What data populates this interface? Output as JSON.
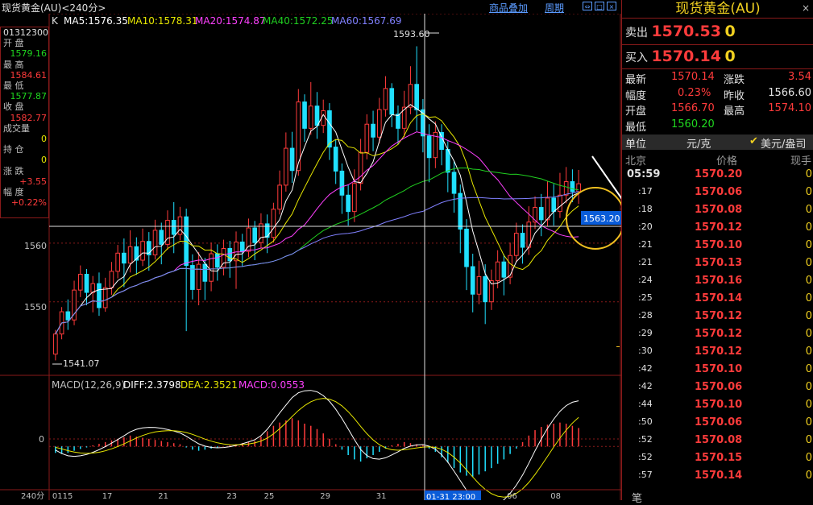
{
  "title": "现货黄金(AU)<240分>",
  "toolbar": {
    "overlay_label": "商品叠加",
    "period_label": "周期"
  },
  "ma_legend": {
    "k": "K",
    "ma5": "MA5:1576.35",
    "ma10": "MA10:1578.31",
    "ma20": "MA20:1574.87",
    "ma40": "MA40:1572.25",
    "ma60": "MA60:1567.69"
  },
  "info_panel": {
    "date": "01312300",
    "open_label": "开  盘",
    "open_value": "1579.16",
    "high_label": "最  高",
    "high_value": "1584.61",
    "low_label": "最  低",
    "low_value": "1577.87",
    "close_label": "收  盘",
    "close_value": "1582.77",
    "volume_label": "成交量",
    "volume_value": "0",
    "hold_label": "持  仓",
    "hold_value": "0",
    "change_label": "涨  跌",
    "change_value": "+3.55",
    "pct_label": "幅  度",
    "pct_value": "+0.22%"
  },
  "price_axis": {
    "label_1560": "1560",
    "label_1550": "1550"
  },
  "annotations": {
    "high": "1593.60",
    "low": "1541.07",
    "crosshair_price": "1563.20",
    "crosshair_time": "01-31 23:00"
  },
  "macd_legend": {
    "name": "MACD(12,26,9)",
    "diff": "DIFF:2.3798",
    "dea": "DEA:2.3521",
    "macd": "MACD:0.0553",
    "zero": "0"
  },
  "x_axis": {
    "period": "240分",
    "labels": [
      "0115",
      "17",
      "21",
      "23",
      "25",
      "29",
      "31",
      "06",
      "08"
    ]
  },
  "right_panel": {
    "title": "现货黄金(AU)",
    "sell_label": "卖出",
    "sell_price": "1570.53",
    "sell_vol": "0",
    "buy_label": "买入",
    "buy_price": "1570.14",
    "buy_vol": "0",
    "quote": {
      "latest_label": "最新",
      "latest_value": "1570.14",
      "change_label": "涨跌",
      "change_value": "3.54",
      "amplitude_label": "幅度",
      "amplitude_value": "0.23%",
      "prev_close_label": "昨收",
      "prev_close_value": "1566.60",
      "open_label": "开盘",
      "open_value": "1566.70",
      "high_label": "最高",
      "high_value": "1574.10",
      "low_label": "最低",
      "low_value": "1560.20"
    },
    "unit_label": "单位",
    "unit_value": "元/克",
    "currency_label": "美元/盎司",
    "tick_header": {
      "time": "北京",
      "price": "价格",
      "vol": "现手"
    },
    "ticks": [
      {
        "time": "05:59",
        "price": "1570.20",
        "vol": "0"
      },
      {
        "time": ":17",
        "price": "1570.06",
        "vol": "0"
      },
      {
        "time": ":18",
        "price": "1570.08",
        "vol": "0"
      },
      {
        "time": ":20",
        "price": "1570.12",
        "vol": "0"
      },
      {
        "time": ":21",
        "price": "1570.10",
        "vol": "0"
      },
      {
        "time": ":21",
        "price": "1570.13",
        "vol": "0"
      },
      {
        "time": ":24",
        "price": "1570.16",
        "vol": "0"
      },
      {
        "time": ":25",
        "price": "1570.14",
        "vol": "0"
      },
      {
        "time": ":28",
        "price": "1570.12",
        "vol": "0"
      },
      {
        "time": ":29",
        "price": "1570.12",
        "vol": "0"
      },
      {
        "time": ":30",
        "price": "1570.12",
        "vol": "0"
      },
      {
        "time": ":42",
        "price": "1570.10",
        "vol": "0"
      },
      {
        "time": ":42",
        "price": "1570.06",
        "vol": "0"
      },
      {
        "time": ":44",
        "price": "1570.10",
        "vol": "0"
      },
      {
        "time": ":50",
        "price": "1570.06",
        "vol": "0"
      },
      {
        "time": ":52",
        "price": "1570.08",
        "vol": "0"
      },
      {
        "time": ":52",
        "price": "1570.15",
        "vol": "0"
      },
      {
        "time": ":57",
        "price": "1570.14",
        "vol": "0"
      }
    ],
    "footer_char": "笔"
  },
  "chart_data": [
    {
      "type": "candlestick",
      "ylim": [
        1538,
        1596
      ],
      "ticks": [
        1550,
        1560
      ],
      "series_colors": {
        "ma5": "#ffffff",
        "ma10": "#e8e800",
        "ma20": "#ff40ff",
        "ma40": "#20d020",
        "ma60": "#8080ff",
        "up": "#ff3b3b",
        "down": "#20e0ff"
      },
      "candles": [
        [
          1541.07,
          1544.5,
          1540.0,
          1545.2
        ],
        [
          1544.5,
          1548.3,
          1543.6,
          1549.1
        ],
        [
          1548.3,
          1546.9,
          1545.2,
          1550.4
        ],
        [
          1546.9,
          1552.0,
          1546.0,
          1553.6
        ],
        [
          1552.0,
          1554.7,
          1550.8,
          1556.2
        ],
        [
          1554.7,
          1551.6,
          1549.4,
          1555.6
        ],
        [
          1551.6,
          1553.1,
          1548.2,
          1554.4
        ],
        [
          1553.1,
          1549.0,
          1547.6,
          1555.0
        ],
        [
          1549.0,
          1552.4,
          1548.3,
          1554.1
        ],
        [
          1552.4,
          1555.2,
          1551.2,
          1556.8
        ],
        [
          1555.2,
          1558.3,
          1554.0,
          1559.7
        ],
        [
          1558.3,
          1556.6,
          1552.5,
          1560.8
        ],
        [
          1556.6,
          1559.4,
          1555.0,
          1562.2
        ],
        [
          1559.4,
          1557.1,
          1554.6,
          1561.0
        ],
        [
          1557.1,
          1560.3,
          1556.1,
          1562.5
        ],
        [
          1560.3,
          1558.0,
          1555.3,
          1561.9
        ],
        [
          1558.0,
          1562.2,
          1557.2,
          1564.0
        ],
        [
          1562.2,
          1559.8,
          1556.4,
          1563.5
        ],
        [
          1559.8,
          1563.9,
          1558.9,
          1565.6
        ],
        [
          1563.9,
          1561.5,
          1558.3,
          1567.0
        ],
        [
          1561.5,
          1564.5,
          1560.5,
          1566.2
        ],
        [
          1564.5,
          1556.2,
          1545.0,
          1565.9
        ],
        [
          1556.2,
          1552.1,
          1550.4,
          1558.1
        ],
        [
          1552.1,
          1556.4,
          1549.4,
          1558.5
        ],
        [
          1556.4,
          1553.5,
          1550.3,
          1557.5
        ],
        [
          1553.5,
          1558.2,
          1551.8,
          1560.1
        ],
        [
          1558.2,
          1555.9,
          1553.6,
          1559.8
        ],
        [
          1555.9,
          1559.1,
          1554.5,
          1560.6
        ],
        [
          1559.1,
          1557.0,
          1554.1,
          1560.4
        ],
        [
          1557.0,
          1560.2,
          1552.2,
          1562.0
        ],
        [
          1560.2,
          1558.6,
          1556.0,
          1561.6
        ],
        [
          1558.6,
          1562.6,
          1557.6,
          1564.2
        ],
        [
          1562.6,
          1560.1,
          1557.1,
          1563.8
        ],
        [
          1560.1,
          1563.3,
          1559.2,
          1565.1
        ],
        [
          1563.3,
          1561.0,
          1558.3,
          1564.9
        ],
        [
          1561.0,
          1565.8,
          1560.1,
          1566.9
        ],
        [
          1565.8,
          1569.9,
          1564.9,
          1572.4
        ],
        [
          1569.9,
          1576.2,
          1568.8,
          1578.9
        ],
        [
          1576.2,
          1572.4,
          1570.3,
          1579.0
        ],
        [
          1572.4,
          1584.1,
          1571.5,
          1586.3
        ],
        [
          1584.1,
          1579.6,
          1577.3,
          1585.4
        ],
        [
          1579.6,
          1583.4,
          1578.5,
          1587.5
        ],
        [
          1583.4,
          1580.1,
          1577.8,
          1585.8
        ],
        [
          1580.1,
          1582.6,
          1578.8,
          1584.5
        ],
        [
          1582.6,
          1576.4,
          1574.2,
          1583.9
        ],
        [
          1576.4,
          1572.3,
          1570.1,
          1577.7
        ],
        [
          1572.3,
          1568.2,
          1565.0,
          1573.6
        ],
        [
          1568.2,
          1565.4,
          1563.0,
          1570.0
        ],
        [
          1565.4,
          1570.2,
          1563.6,
          1572.6
        ],
        [
          1570.2,
          1575.5,
          1569.0,
          1577.8
        ],
        [
          1575.5,
          1580.3,
          1574.3,
          1582.0
        ],
        [
          1580.3,
          1578.1,
          1575.7,
          1582.6
        ],
        [
          1578.1,
          1582.8,
          1577.0,
          1584.8
        ],
        [
          1582.8,
          1586.4,
          1581.6,
          1588.5
        ],
        [
          1586.4,
          1582.0,
          1579.8,
          1587.3
        ],
        [
          1582.0,
          1579.6,
          1576.8,
          1583.5
        ],
        [
          1579.6,
          1583.2,
          1578.1,
          1586.0
        ],
        [
          1583.2,
          1587.1,
          1582.0,
          1590.2
        ],
        [
          1587.1,
          1582.77,
          1579.16,
          1593.6
        ],
        [
          1582.77,
          1578.3,
          1575.5,
          1584.6
        ],
        [
          1578.3,
          1574.6,
          1570.4,
          1580.3
        ],
        [
          1574.6,
          1578.9,
          1572.8,
          1580.8
        ],
        [
          1578.9,
          1576.0,
          1573.3,
          1580.3
        ],
        [
          1576.0,
          1572.1,
          1568.7,
          1577.4
        ],
        [
          1572.1,
          1568.5,
          1565.2,
          1574.0
        ],
        [
          1568.5,
          1562.4,
          1558.3,
          1570.0
        ],
        [
          1562.4,
          1556.0,
          1552.0,
          1564.1
        ],
        [
          1556.0,
          1551.3,
          1548.2,
          1558.2
        ],
        [
          1551.3,
          1554.3,
          1549.6,
          1557.0
        ],
        [
          1554.3,
          1550.0,
          1546.2,
          1556.4
        ],
        [
          1550.0,
          1553.6,
          1548.6,
          1555.5
        ],
        [
          1553.6,
          1556.8,
          1552.3,
          1558.8
        ],
        [
          1556.8,
          1554.2,
          1551.1,
          1558.1
        ],
        [
          1554.2,
          1557.9,
          1553.0,
          1560.1
        ],
        [
          1557.9,
          1561.7,
          1556.8,
          1563.5
        ],
        [
          1561.7,
          1559.3,
          1556.5,
          1563.2
        ],
        [
          1559.3,
          1563.6,
          1558.0,
          1566.3
        ],
        [
          1563.6,
          1566.1,
          1562.4,
          1568.0
        ],
        [
          1566.1,
          1564.0,
          1561.2,
          1568.4
        ],
        [
          1564.0,
          1567.7,
          1562.9,
          1570.6
        ],
        [
          1567.7,
          1565.4,
          1563.0,
          1570.1
        ],
        [
          1565.4,
          1568.2,
          1564.3,
          1572.0
        ],
        [
          1568.2,
          1570.5,
          1566.8,
          1573.0
        ],
        [
          1570.5,
          1568.8,
          1567.0,
          1572.6
        ],
        [
          1568.8,
          1570.14,
          1566.7,
          1572.5
        ]
      ]
    },
    {
      "type": "bar",
      "title": "MACD(12,26,9)",
      "ylim": [
        -2.5,
        3.2
      ],
      "macd_values": [
        -0.3,
        -0.35,
        -0.3,
        -0.2,
        -0.12,
        -0.05,
        0.05,
        0.12,
        0.2,
        0.28,
        0.35,
        0.42,
        0.5,
        0.45,
        0.4,
        0.35,
        0.3,
        0.25,
        0.2,
        0.15,
        0.1,
        -0.05,
        -0.15,
        -0.2,
        -0.15,
        -0.1,
        -0.05,
        0.0,
        0.05,
        0.1,
        0.15,
        0.2,
        0.25,
        0.45,
        0.7,
        0.95,
        1.1,
        1.2,
        1.3,
        1.2,
        1.05,
        0.95,
        0.8,
        0.6,
        0.35,
        0.1,
        -0.15,
        -0.4,
        -0.6,
        -0.7,
        -0.55,
        -0.4,
        -0.25,
        -0.1,
        0.05,
        0.12,
        0.2,
        0.15,
        0.1,
        0.05,
        -0.1,
        -0.25,
        -0.5,
        -0.75,
        -1.0,
        -1.2,
        -1.35,
        -1.4,
        -1.3,
        -1.15,
        -1.0,
        -0.8,
        -0.6,
        -0.35,
        -0.1,
        0.2,
        0.5,
        0.75,
        0.9,
        1.0,
        1.05,
        1.1,
        1.05,
        0.95,
        0.85
      ]
    }
  ]
}
